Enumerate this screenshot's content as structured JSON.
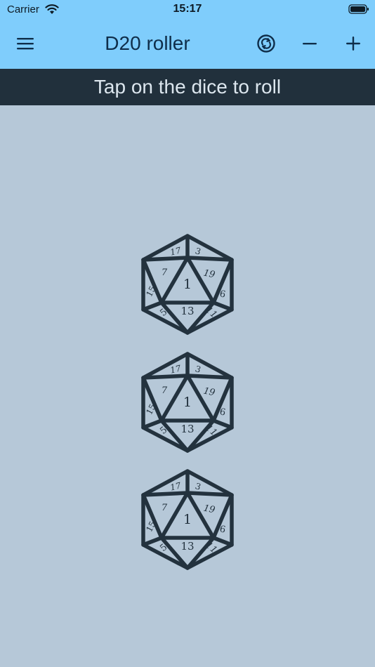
{
  "status_bar": {
    "carrier": "Carrier",
    "time": "15:17"
  },
  "nav": {
    "title": "D20 roller",
    "menu_icon": "hamburger-menu-icon",
    "actions": [
      "reset-dice-icon",
      "remove-die-icon",
      "add-die-icon"
    ]
  },
  "banner": {
    "text": "Tap on the dice to roll"
  },
  "dice": [
    {
      "top_face": "1",
      "faces": [
        "17",
        "3",
        "7",
        "19",
        "15",
        "6",
        "5",
        "13",
        "11"
      ]
    },
    {
      "top_face": "1",
      "faces": [
        "17",
        "3",
        "7",
        "19",
        "15",
        "6",
        "5",
        "13",
        "11"
      ]
    },
    {
      "top_face": "1",
      "faces": [
        "17",
        "3",
        "7",
        "19",
        "15",
        "6",
        "5",
        "13",
        "11"
      ]
    }
  ],
  "colors": {
    "header": "#7fcdfc",
    "banner": "#21303c",
    "background": "#b6c8d8",
    "die_stroke": "#23323e"
  }
}
